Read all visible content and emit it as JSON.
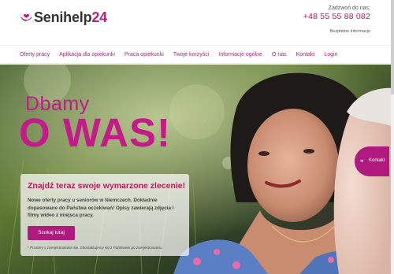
{
  "header": {
    "logo": {
      "text_main": "Senihelp",
      "text_accent": "24"
    },
    "call_label": "Zadzwoń do nas:",
    "phone": "+48 55 55 88 082",
    "free_info": "Bezpłatne informacje"
  },
  "nav": {
    "items": [
      {
        "label": "Oferty pracy"
      },
      {
        "label": "Aplikacja dla opiekunki"
      },
      {
        "label": "Praca opiekunki"
      },
      {
        "label": "Twoje korzyści"
      },
      {
        "label": "Informacje ogólne"
      },
      {
        "label": "O nas"
      },
      {
        "label": "Kontakt"
      },
      {
        "label": "Login"
      }
    ]
  },
  "hero": {
    "headline_1": "Dbamy",
    "headline_2": "O WAS!",
    "card": {
      "title": "Znajdź teraz swoje wymarzone zlecenie!",
      "description": "Nowe oferty pracy u seniorów w Niemczech. Dokładnie dopasowane do Państwa oczekiwań! Opisy zawierają zdjęcia i filmy wideo z miejsca pracy.",
      "button": "Szukaj tutaj",
      "note": "* Prosimy o zarejestrowanie się. Skontaktujemy się z Państwem po zarejestrowaniu."
    },
    "contact_tab": {
      "label": "Kontakt",
      "icon": "arrow-icon"
    }
  },
  "colors": {
    "brand": "#b1227f",
    "button": "#b01a7e",
    "phone": "#c2185b"
  }
}
